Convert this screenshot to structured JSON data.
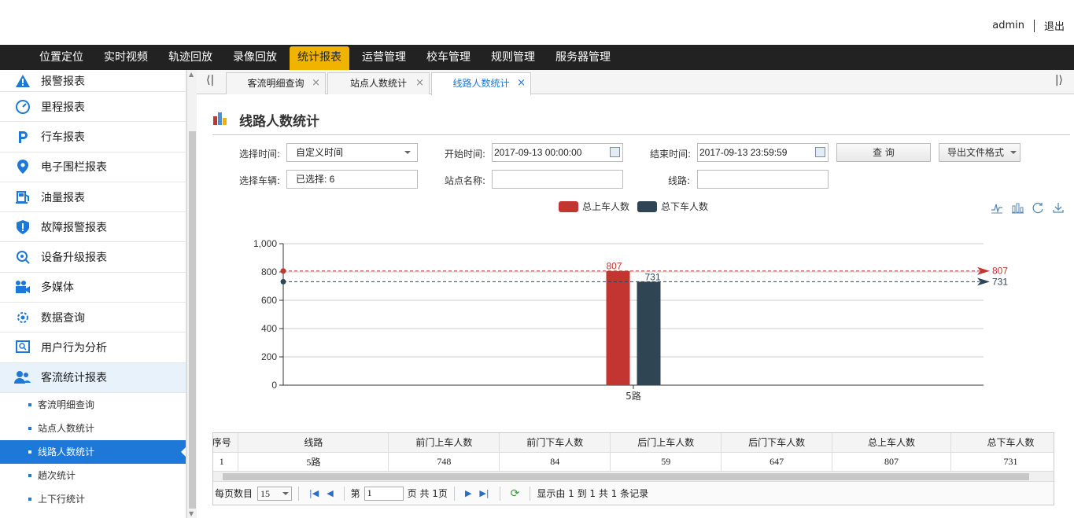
{
  "header": {
    "username": "admin",
    "logout": "退出"
  },
  "nav": [
    "位置定位",
    "实时视频",
    "轨迹回放",
    "录像回放",
    "统计报表",
    "运营管理",
    "校车管理",
    "规则管理",
    "服务器管理"
  ],
  "nav_active": "统计报表",
  "sidebar": {
    "items": [
      "报警报表",
      "里程报表",
      "行车报表",
      "电子围栏报表",
      "油量报表",
      "故障报警报表",
      "设备升级报表",
      "多媒体",
      "数据查询",
      "用户行为分析",
      "客流统计报表"
    ],
    "sub_items": [
      "客流明细查询",
      "站点人数统计",
      "线路人数统计",
      "趟次统计",
      "上下行统计"
    ],
    "active_sub": "线路人数统计"
  },
  "tabs": [
    "客流明细查询",
    "站点人数统计",
    "线路人数统计"
  ],
  "tab_close": "×",
  "page_title": "线路人数统计",
  "form": {
    "time_label": "选择时间:",
    "time_value": "自定义时间",
    "start_label": "开始时间:",
    "start_value": "2017-09-13 00:00:00",
    "end_label": "结束时间:",
    "end_value": "2017-09-13 23:59:59",
    "query_btn": "查 询",
    "export_btn": "导出文件格式",
    "vehicle_label": "选择车辆:",
    "vehicle_value": "已选择: 6",
    "station_label": "站点名称:",
    "station_value": "",
    "route_label": "线路:",
    "route_value": ""
  },
  "chart_data": {
    "type": "bar",
    "categories": [
      "5路"
    ],
    "series": [
      {
        "name": "总上车人数",
        "values": [
          807
        ],
        "color": "#c23531"
      },
      {
        "name": "总下车人数",
        "values": [
          731
        ],
        "color": "#2f4554"
      }
    ],
    "ylim": [
      0,
      1000
    ],
    "yticks": [
      "0",
      "200",
      "400",
      "600",
      "800",
      "1,000"
    ],
    "data_labels": [
      "807",
      "731"
    ],
    "mark_lines": [
      "807",
      "731"
    ],
    "legend_position": "top-center",
    "grid": true
  },
  "table": {
    "headers": [
      "序号",
      "线路",
      "前门上车人数",
      "前门下车人数",
      "后门上车人数",
      "后门下车人数",
      "总上车人数",
      "总下车人数"
    ],
    "rows": [
      [
        "1",
        "5路",
        "748",
        "84",
        "59",
        "647",
        "807",
        "731"
      ]
    ]
  },
  "pager": {
    "per_page_label": "每页数目",
    "per_page": "15",
    "page_prefix": "第",
    "page_value": "1",
    "page_suffix": "页 共 1页",
    "summary": "显示由 1 到 1 共 1 条记录"
  }
}
